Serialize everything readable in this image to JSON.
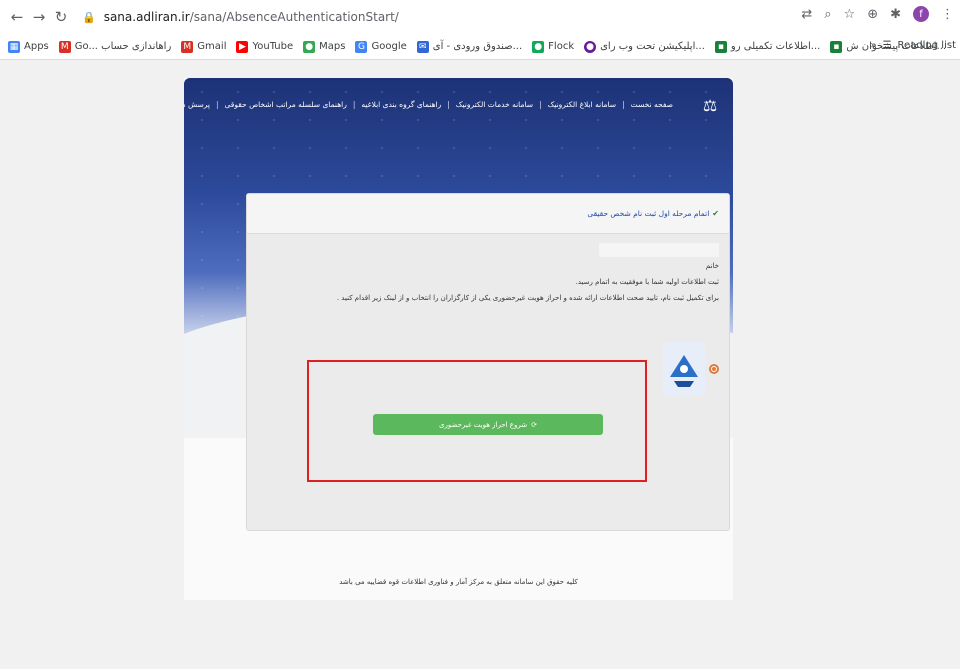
{
  "browser": {
    "url_host": "sana.adliran.ir",
    "url_path": "/sana/AbsenceAuthenticationStart/",
    "profile_initial": "f"
  },
  "bookmarks": [
    {
      "label": "Apps",
      "icon": "apps-grid-icon",
      "color": "#4285f4"
    },
    {
      "label": "Go... راهاندازی حساب",
      "icon": "gmail-icon",
      "color": "#d93025"
    },
    {
      "label": "Gmail",
      "icon": "gmail-icon",
      "color": "#d93025"
    },
    {
      "label": "YouTube",
      "icon": "youtube-icon",
      "color": "#ff0000"
    },
    {
      "label": "Maps",
      "icon": "maps-pin-icon",
      "color": "#34a853"
    },
    {
      "label": "Google",
      "icon": "google-icon",
      "color": "#4285f4"
    },
    {
      "label": "صندوق ورودی - آی...",
      "icon": "mail-icon",
      "color": "#3367d6"
    },
    {
      "label": "Flock",
      "icon": "flock-icon",
      "color": "#0fa958"
    },
    {
      "label": "اپلیکیشن تحت وب رای...",
      "icon": "purple-circle-icon",
      "color": "#6a1b9a"
    },
    {
      "label": "اطلاعات تکمیلی رو...",
      "icon": "green-square-icon",
      "color": "#188038"
    },
    {
      "label": "اطلاعات پیشخوان ش...",
      "icon": "green-square-icon",
      "color": "#188038"
    }
  ],
  "reading_list": "Reading list",
  "site": {
    "nav": [
      "صفحه نخست",
      "سامانه ابلاغ الکترونیک",
      "سامانه خدمات الکترونیک",
      "راهنمای گروه بندی ابلاغیه",
      "راهنمای سلسله مراتب اشخاص حقوقی",
      "پرسش های متداول"
    ],
    "card_title": "اتمام مرحله اول ثبت نام شخص حقیقی",
    "greeting": "خانم",
    "line1": "ثبت اطلاعات اولیه شما با موفقیت به اتمام رسید.",
    "line2": "برای تکمیل ثبت نام، تایید صحت اطلاعات ارائه شده و احراز هویت غیرحضوری یکی از کارگزاران را انتخاب و از لینک زیر اقدام کنید .",
    "start_button": "شروع احراز هویت غیرحضوری",
    "footer": "کلیه حقوق این سامانه متعلق به مرکز آمار و فناوری اطلاعات قوه قضاییه می باشد"
  }
}
